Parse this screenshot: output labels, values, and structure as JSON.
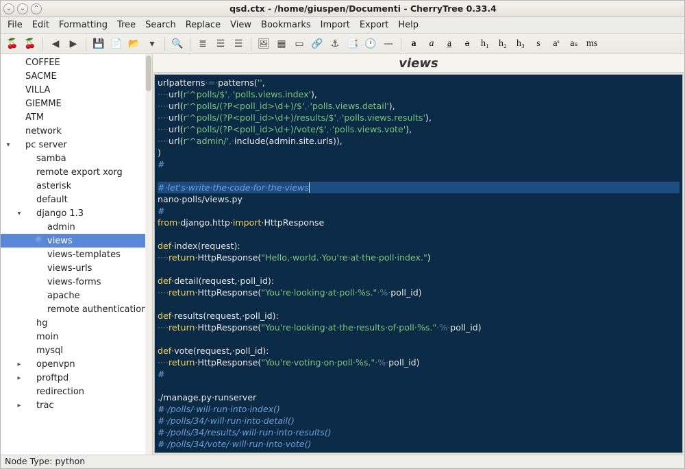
{
  "window": {
    "title": "qsd.ctx - /home/giuspen/Documenti - CherryTree 0.33.4",
    "controls": {
      "minimize": "⌄",
      "maximize": "⌄",
      "close": "⌃"
    }
  },
  "menubar": [
    "File",
    "Edit",
    "Formatting",
    "Tree",
    "Search",
    "Replace",
    "View",
    "Bookmarks",
    "Import",
    "Export",
    "Help"
  ],
  "toolbar": {
    "items": [
      {
        "icon": "🍒",
        "name": "cherry-red-icon"
      },
      {
        "icon": "🍒",
        "name": "cherry-add-icon"
      },
      {
        "sep": true
      },
      {
        "icon": "◀",
        "name": "nav-back-icon",
        "cls": "orange"
      },
      {
        "icon": "▶",
        "name": "nav-fwd-icon",
        "cls": "orange"
      },
      {
        "sep": true
      },
      {
        "icon": "💾",
        "name": "save-icon"
      },
      {
        "icon": "📄",
        "name": "export-pdf-icon"
      },
      {
        "icon": "📂",
        "name": "open-icon"
      },
      {
        "icon": "▾",
        "name": "recent-dropdown-icon"
      },
      {
        "sep": true
      },
      {
        "icon": "🔍",
        "name": "search-icon"
      },
      {
        "sep": true
      },
      {
        "icon": "≣",
        "name": "list-bullet-icon"
      },
      {
        "icon": "☰",
        "name": "list-num-icon"
      },
      {
        "icon": "☰",
        "name": "list-todo-icon"
      },
      {
        "sep": true
      },
      {
        "icon": "🖼",
        "name": "insert-image-icon"
      },
      {
        "icon": "▦",
        "name": "insert-table-icon"
      },
      {
        "icon": "▭",
        "name": "insert-codebox-icon"
      },
      {
        "icon": "🔗",
        "name": "insert-link-icon"
      },
      {
        "icon": "⚓",
        "name": "insert-anchor-icon"
      },
      {
        "icon": "📑",
        "name": "insert-toc-icon"
      },
      {
        "icon": "🕐",
        "name": "insert-timestamp-icon"
      },
      {
        "icon": "—",
        "name": "insert-hr-icon"
      },
      {
        "sep": true
      },
      {
        "icon": "a",
        "name": "fmt-bold",
        "cls": "fmt",
        "style": "font-weight:bold"
      },
      {
        "icon": "a",
        "name": "fmt-italic",
        "cls": "fmt",
        "style": "font-style:italic"
      },
      {
        "icon": "a",
        "name": "fmt-underline",
        "cls": "fmt",
        "style": "text-decoration:underline"
      },
      {
        "icon": "a",
        "name": "fmt-strike",
        "cls": "fmt",
        "style": "text-decoration:line-through"
      },
      {
        "icon": "h₁",
        "name": "fmt-h1",
        "cls": "fmt"
      },
      {
        "icon": "h₂",
        "name": "fmt-h2",
        "cls": "fmt"
      },
      {
        "icon": "h₃",
        "name": "fmt-h3",
        "cls": "fmt"
      },
      {
        "icon": "s",
        "name": "fmt-small",
        "cls": "fmt"
      },
      {
        "icon": "aˢ",
        "name": "fmt-sup",
        "cls": "fmt"
      },
      {
        "icon": "aₛ",
        "name": "fmt-sub",
        "cls": "fmt"
      },
      {
        "icon": "ms",
        "name": "fmt-mono",
        "cls": "fmt"
      }
    ]
  },
  "tree": [
    {
      "depth": 0,
      "tw": "",
      "color": "c-red",
      "label": "COFFEE"
    },
    {
      "depth": 0,
      "tw": "",
      "color": "c-red",
      "label": "SACME"
    },
    {
      "depth": 0,
      "tw": "",
      "color": "c-red",
      "label": "VILLA"
    },
    {
      "depth": 0,
      "tw": "",
      "color": "c-red",
      "label": "GIEMME"
    },
    {
      "depth": 0,
      "tw": "",
      "color": "c-purple",
      "label": "ATM"
    },
    {
      "depth": 0,
      "tw": "",
      "color": "c-purple",
      "label": "network"
    },
    {
      "depth": 0,
      "tw": "▾",
      "color": "c-purple",
      "label": "pc server"
    },
    {
      "depth": 1,
      "tw": "",
      "color": "c-purple",
      "label": "samba"
    },
    {
      "depth": 1,
      "tw": "",
      "color": "c-purple",
      "label": "remote export xorg"
    },
    {
      "depth": 1,
      "tw": "",
      "color": "c-purple",
      "label": "asterisk"
    },
    {
      "depth": 1,
      "tw": "",
      "color": "c-gray",
      "label": "default"
    },
    {
      "depth": 1,
      "tw": "▾",
      "color": "c-purple",
      "label": "django 1.3"
    },
    {
      "depth": 2,
      "tw": "",
      "color": "c-green",
      "label": "admin"
    },
    {
      "depth": 2,
      "tw": "",
      "color": "c-green",
      "label": "views",
      "selected": true
    },
    {
      "depth": 2,
      "tw": "",
      "color": "c-green",
      "label": "views-templates"
    },
    {
      "depth": 2,
      "tw": "",
      "color": "c-green",
      "label": "views-urls"
    },
    {
      "depth": 2,
      "tw": "",
      "color": "c-green",
      "label": "views-forms"
    },
    {
      "depth": 2,
      "tw": "",
      "color": "c-green",
      "label": "apache"
    },
    {
      "depth": 2,
      "tw": "",
      "color": "c-green",
      "label": "remote authentication"
    },
    {
      "depth": 1,
      "tw": "",
      "color": "c-blue",
      "label": "hg"
    },
    {
      "depth": 1,
      "tw": "",
      "color": "c-purple",
      "label": "moin"
    },
    {
      "depth": 1,
      "tw": "",
      "color": "c-purple",
      "label": "mysql"
    },
    {
      "depth": 1,
      "tw": "▸",
      "color": "c-purple",
      "label": "openvpn"
    },
    {
      "depth": 1,
      "tw": "▸",
      "color": "c-purple",
      "label": "proftpd"
    },
    {
      "depth": 1,
      "tw": "",
      "color": "c-purple",
      "label": "redirection"
    },
    {
      "depth": 1,
      "tw": "▸",
      "color": "c-purple",
      "label": "trac"
    }
  ],
  "doc": {
    "title": "views"
  },
  "code": {
    "lines": [
      [
        {
          "t": "urlpatterns",
          "c": "fn"
        },
        {
          "t": "·=·",
          "c": "dim"
        },
        {
          "t": "patterns",
          "c": "fn"
        },
        {
          "t": "(",
          "c": "op"
        },
        {
          "t": "''",
          "c": "str"
        },
        {
          "t": ",",
          "c": "op"
        }
      ],
      [
        {
          "t": "····",
          "c": "dim"
        },
        {
          "t": "url",
          "c": "fn"
        },
        {
          "t": "(",
          "c": "op"
        },
        {
          "t": "r'^polls/$'",
          "c": "str"
        },
        {
          "t": ",·",
          "c": "dim"
        },
        {
          "t": "'polls.views.index'",
          "c": "str"
        },
        {
          "t": "),",
          "c": "op"
        }
      ],
      [
        {
          "t": "····",
          "c": "dim"
        },
        {
          "t": "url",
          "c": "fn"
        },
        {
          "t": "(",
          "c": "op"
        },
        {
          "t": "r'^polls/(?P<poll_id>\\d+)/$'",
          "c": "str"
        },
        {
          "t": ",·",
          "c": "dim"
        },
        {
          "t": "'polls.views.detail'",
          "c": "str"
        },
        {
          "t": "),",
          "c": "op"
        }
      ],
      [
        {
          "t": "····",
          "c": "dim"
        },
        {
          "t": "url",
          "c": "fn"
        },
        {
          "t": "(",
          "c": "op"
        },
        {
          "t": "r'^polls/(?P<poll_id>\\d+)/results/$'",
          "c": "str"
        },
        {
          "t": ",·",
          "c": "dim"
        },
        {
          "t": "'polls.views.results'",
          "c": "str"
        },
        {
          "t": "),",
          "c": "op"
        }
      ],
      [
        {
          "t": "····",
          "c": "dim"
        },
        {
          "t": "url",
          "c": "fn"
        },
        {
          "t": "(",
          "c": "op"
        },
        {
          "t": "r'^polls/(?P<poll_id>\\d+)/vote/$'",
          "c": "str"
        },
        {
          "t": ",·",
          "c": "dim"
        },
        {
          "t": "'polls.views.vote'",
          "c": "str"
        },
        {
          "t": "),",
          "c": "op"
        }
      ],
      [
        {
          "t": "····",
          "c": "dim"
        },
        {
          "t": "url",
          "c": "fn"
        },
        {
          "t": "(",
          "c": "op"
        },
        {
          "t": "r'^admin/'",
          "c": "str"
        },
        {
          "t": ",·",
          "c": "dim"
        },
        {
          "t": "include",
          "c": "fn"
        },
        {
          "t": "(admin.site.urls)),",
          "c": "op"
        }
      ],
      [
        {
          "t": ")",
          "c": "op"
        }
      ],
      [
        {
          "t": "#",
          "c": "cmt"
        }
      ],
      [],
      [
        {
          "t": "#·let's·write·the·code·for·the·views",
          "c": "cmt",
          "hl": true
        }
      ],
      [
        {
          "t": "nano·",
          "c": "fn"
        },
        {
          "t": "polls/views.py",
          "c": "fn"
        }
      ],
      [
        {
          "t": "#",
          "c": "cmt"
        }
      ],
      [
        {
          "t": "from·",
          "c": "kw"
        },
        {
          "t": "django.http·",
          "c": "fn"
        },
        {
          "t": "import·",
          "c": "kw"
        },
        {
          "t": "HttpResponse",
          "c": "fn"
        }
      ],
      [],
      [
        {
          "t": "def·",
          "c": "kw"
        },
        {
          "t": "index",
          "c": "fn"
        },
        {
          "t": "(request):",
          "c": "op"
        }
      ],
      [
        {
          "t": "····",
          "c": "dim"
        },
        {
          "t": "return·",
          "c": "kw"
        },
        {
          "t": "HttpResponse",
          "c": "fn"
        },
        {
          "t": "(",
          "c": "op"
        },
        {
          "t": "\"Hello,·world.·You're·at·the·poll·index.\"",
          "c": "str"
        },
        {
          "t": ")",
          "c": "op"
        }
      ],
      [],
      [
        {
          "t": "def·",
          "c": "kw"
        },
        {
          "t": "detail",
          "c": "fn"
        },
        {
          "t": "(request,·poll_id):",
          "c": "op"
        }
      ],
      [
        {
          "t": "····",
          "c": "dim"
        },
        {
          "t": "return·",
          "c": "kw"
        },
        {
          "t": "HttpResponse",
          "c": "fn"
        },
        {
          "t": "(",
          "c": "op"
        },
        {
          "t": "\"You're·looking·at·poll·%s.\"",
          "c": "str"
        },
        {
          "t": "·%·",
          "c": "dim"
        },
        {
          "t": "poll_id)",
          "c": "op"
        }
      ],
      [],
      [
        {
          "t": "def·",
          "c": "kw"
        },
        {
          "t": "results",
          "c": "fn"
        },
        {
          "t": "(request,·poll_id):",
          "c": "op"
        }
      ],
      [
        {
          "t": "····",
          "c": "dim"
        },
        {
          "t": "return·",
          "c": "kw"
        },
        {
          "t": "HttpResponse",
          "c": "fn"
        },
        {
          "t": "(",
          "c": "op"
        },
        {
          "t": "\"You're·looking·at·the·results·of·poll·%s.\"",
          "c": "str"
        },
        {
          "t": "·%·",
          "c": "dim"
        },
        {
          "t": "poll_id)",
          "c": "op"
        }
      ],
      [],
      [
        {
          "t": "def·",
          "c": "kw"
        },
        {
          "t": "vote",
          "c": "fn"
        },
        {
          "t": "(request,·poll_id):",
          "c": "op"
        }
      ],
      [
        {
          "t": "····",
          "c": "dim"
        },
        {
          "t": "return·",
          "c": "kw"
        },
        {
          "t": "HttpResponse",
          "c": "fn"
        },
        {
          "t": "(",
          "c": "op"
        },
        {
          "t": "\"You're·voting·on·poll·%s.\"",
          "c": "str"
        },
        {
          "t": "·%·",
          "c": "dim"
        },
        {
          "t": "poll_id)",
          "c": "op"
        }
      ],
      [
        {
          "t": "#",
          "c": "cmt"
        }
      ],
      [],
      [
        {
          "t": "./manage.py·runserver",
          "c": "fn"
        }
      ],
      [
        {
          "t": "#·/polls/·will·run·into·index()",
          "c": "cmt"
        }
      ],
      [
        {
          "t": "#·/polls/34/·will·run·into·detail()",
          "c": "cmt"
        }
      ],
      [
        {
          "t": "#·/polls/34/results/·will·run·into·results()",
          "c": "cmt"
        }
      ],
      [
        {
          "t": "#·/polls/34/vote/·will·run·into·vote()",
          "c": "cmt"
        }
      ]
    ]
  },
  "statusbar": {
    "text": "Node Type: python"
  }
}
